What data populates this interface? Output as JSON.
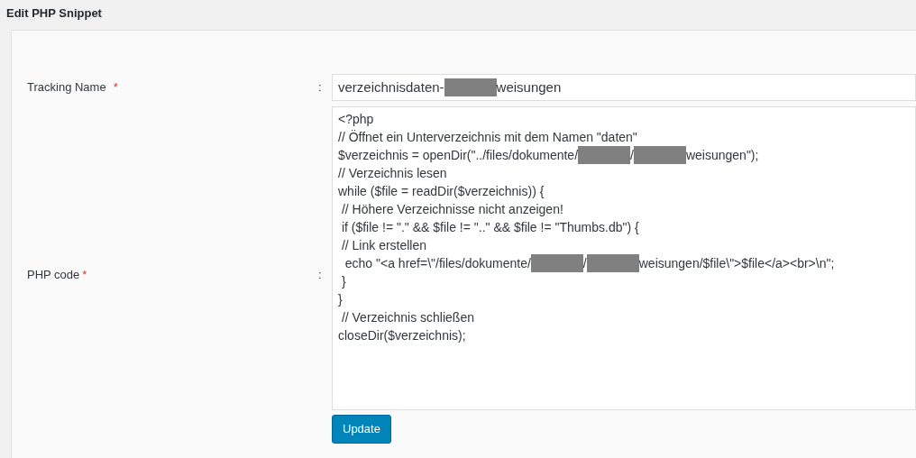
{
  "title": "Edit PHP Snippet",
  "tracking_name": {
    "label": "Tracking Name",
    "required": "*",
    "separator": ":",
    "value": [
      {
        "kind": "text",
        "text": "verzeichnisdaten-"
      },
      {
        "kind": "redacted"
      },
      {
        "kind": "text",
        "text": "weisungen"
      }
    ]
  },
  "php_code": {
    "label": "PHP code",
    "required": "*",
    "separator": ":",
    "lines": [
      [
        {
          "kind": "text",
          "text": "<?php"
        }
      ],
      [
        {
          "kind": "text",
          "text": "// Öffnet ein Unterverzeichnis mit dem Namen \"daten\""
        }
      ],
      [
        {
          "kind": "text",
          "text": "$verzeichnis = openDir(\"../files/dokumente/"
        },
        {
          "kind": "redacted"
        },
        {
          "kind": "text",
          "text": "/"
        },
        {
          "kind": "redacted"
        },
        {
          "kind": "text",
          "text": "weisungen\");"
        }
      ],
      [
        {
          "kind": "text",
          "text": "// Verzeichnis lesen"
        }
      ],
      [
        {
          "kind": "text",
          "text": "while ($file = readDir($verzeichnis)) {"
        }
      ],
      [
        {
          "kind": "text",
          "text": " // Höhere Verzeichnisse nicht anzeigen!"
        }
      ],
      [
        {
          "kind": "text",
          "text": " if ($file != \".\" && $file != \"..\" && $file != \"Thumbs.db\") {"
        }
      ],
      [
        {
          "kind": "text",
          "text": " // Link erstellen"
        }
      ],
      [
        {
          "kind": "text",
          "text": "  echo \"<a href=\\\"/files/dokumente/"
        },
        {
          "kind": "redacted"
        },
        {
          "kind": "text",
          "text": "/"
        },
        {
          "kind": "redacted"
        },
        {
          "kind": "text",
          "text": "weisungen/$file\\\">$file</a><br>\\n\";"
        }
      ],
      [
        {
          "kind": "text",
          "text": " }"
        }
      ],
      [
        {
          "kind": "text",
          "text": "}"
        }
      ],
      [
        {
          "kind": "text",
          "text": " // Verzeichnis schließen"
        }
      ],
      [
        {
          "kind": "text",
          "text": "closeDir($verzeichnis);"
        }
      ]
    ]
  },
  "button": "Update"
}
